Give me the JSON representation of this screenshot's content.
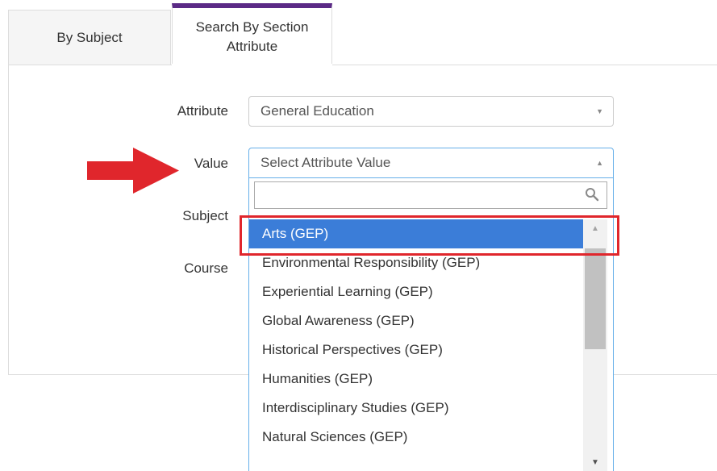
{
  "tabs": [
    {
      "label": "By Subject",
      "active": false
    },
    {
      "label": "Search By Section Attribute",
      "active": true
    }
  ],
  "form": {
    "attribute": {
      "label": "Attribute",
      "value": "General Education"
    },
    "value": {
      "label": "Value",
      "placeholder": "Select Attribute Value"
    },
    "subject": {
      "label": "Subject"
    },
    "course": {
      "label": "Course"
    }
  },
  "dropdown": {
    "search_value": "",
    "options": [
      "Arts (GEP)",
      "Environmental Responsibility (GEP)",
      "Experiential Learning (GEP)",
      "Global Awareness (GEP)",
      "Historical Perspectives (GEP)",
      "Humanities (GEP)",
      "Interdisciplinary Studies (GEP)",
      "Natural Sciences (GEP)"
    ],
    "highlighted_index": 0,
    "icons": {
      "search": "search-icon",
      "scroll_up": "scroll-up-arrow-icon",
      "scroll_down": "scroll-down-arrow-icon"
    }
  },
  "colors": {
    "active_tab_accent": "#5b2a86",
    "option_highlight": "#3b7dd8",
    "annotation_red": "#e0262c"
  }
}
